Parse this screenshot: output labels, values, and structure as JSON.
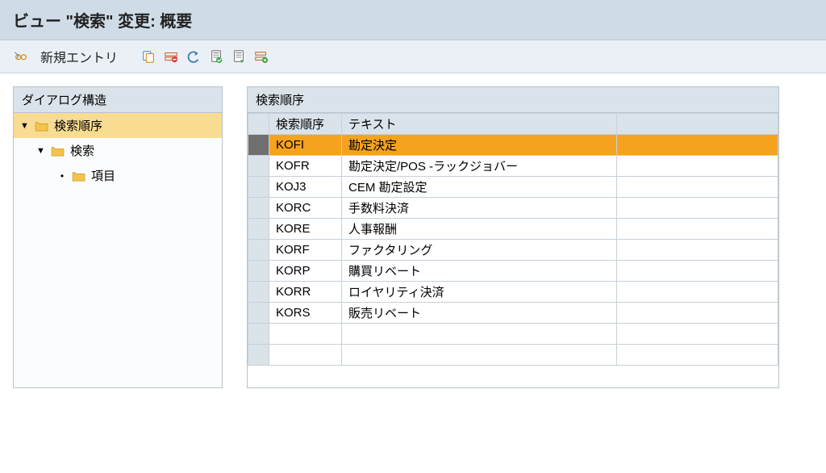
{
  "title": "ビュー \"検索\" 変更: 概要",
  "toolbar": {
    "new_entry_label": "新規エントリ"
  },
  "tree": {
    "header": "ダイアログ構造",
    "items": [
      {
        "label": "検索順序",
        "level": 0,
        "expand": "▼",
        "selected": true,
        "is_folder": true
      },
      {
        "label": "検索",
        "level": 1,
        "expand": "▼",
        "selected": false,
        "is_folder": true
      },
      {
        "label": "項目",
        "level": 2,
        "expand": "•",
        "selected": false,
        "is_folder": true
      }
    ]
  },
  "table": {
    "title": "検索順序",
    "columns": {
      "code": "検索順序",
      "text": "テキスト"
    },
    "rows": [
      {
        "code": "KOFI",
        "text": "勘定決定",
        "selected": true
      },
      {
        "code": "KOFR",
        "text": "勘定決定/POS -ラックジョバー",
        "selected": false
      },
      {
        "code": "KOJ3",
        "text": "CEM 勘定設定",
        "selected": false
      },
      {
        "code": "KORC",
        "text": "手数料決済",
        "selected": false
      },
      {
        "code": "KORE",
        "text": "人事報酬",
        "selected": false
      },
      {
        "code": "KORF",
        "text": "ファクタリング",
        "selected": false
      },
      {
        "code": "KORP",
        "text": "購買リベート",
        "selected": false
      },
      {
        "code": "KORR",
        "text": "ロイヤリティ決済",
        "selected": false
      },
      {
        "code": "KORS",
        "text": "販売リベート",
        "selected": false
      },
      {
        "code": "",
        "text": "",
        "selected": false
      },
      {
        "code": "",
        "text": "",
        "selected": false
      }
    ]
  }
}
